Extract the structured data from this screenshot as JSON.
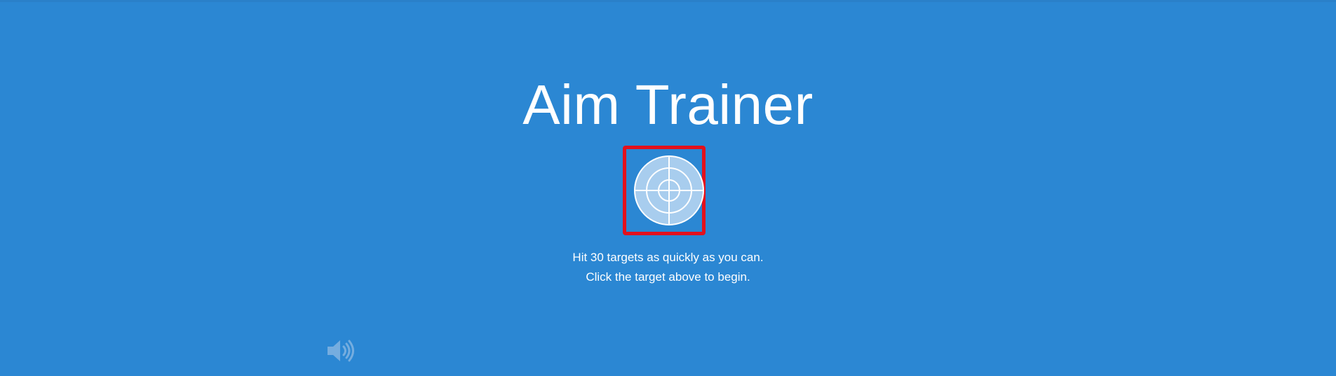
{
  "game": {
    "title": "Aim Trainer",
    "start_target_icon": "target-icon",
    "instructions": {
      "line1": "Hit 30 targets as quickly as you can.",
      "line2": "Click the target above to begin."
    },
    "sound_icon": "speaker-volume-icon"
  },
  "colors": {
    "background": "#2b87d3",
    "highlight_border": "#e3101c",
    "text": "#ffffff"
  }
}
